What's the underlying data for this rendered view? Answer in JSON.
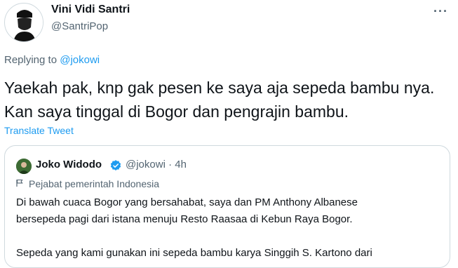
{
  "author": {
    "name": "Vini Vidi Santri",
    "handle": "@SantriPop"
  },
  "more_icon": "more-dots-icon",
  "replying": {
    "prefix": "Replying to ",
    "mention": "@jokowi"
  },
  "tweet_text": "Yaekah pak, knp gak pesen ke saya aja sepeda bambu nya. Kan saya tinggal di Bogor dan pengrajin bambu.",
  "translate_label": "Translate Tweet",
  "quoted": {
    "name": "Joko Widodo",
    "handle": "@jokowi",
    "separator": "·",
    "time": "4h",
    "label": "Pejabat pemerintah Indonesia",
    "text": "Di bawah cuaca Bogor yang bersahabat, saya dan PM Anthony Albanese\nbersepeda pagi dari istana menuju Resto Raasaa di Kebun Raya Bogor.\n\nSepeda yang kami gunakan ini sepeda bambu karya Singgih S. Kartono dari"
  },
  "colors": {
    "accent": "#1d9bf0",
    "muted": "#536471",
    "text": "#0f1419",
    "border": "#cfd9de"
  }
}
